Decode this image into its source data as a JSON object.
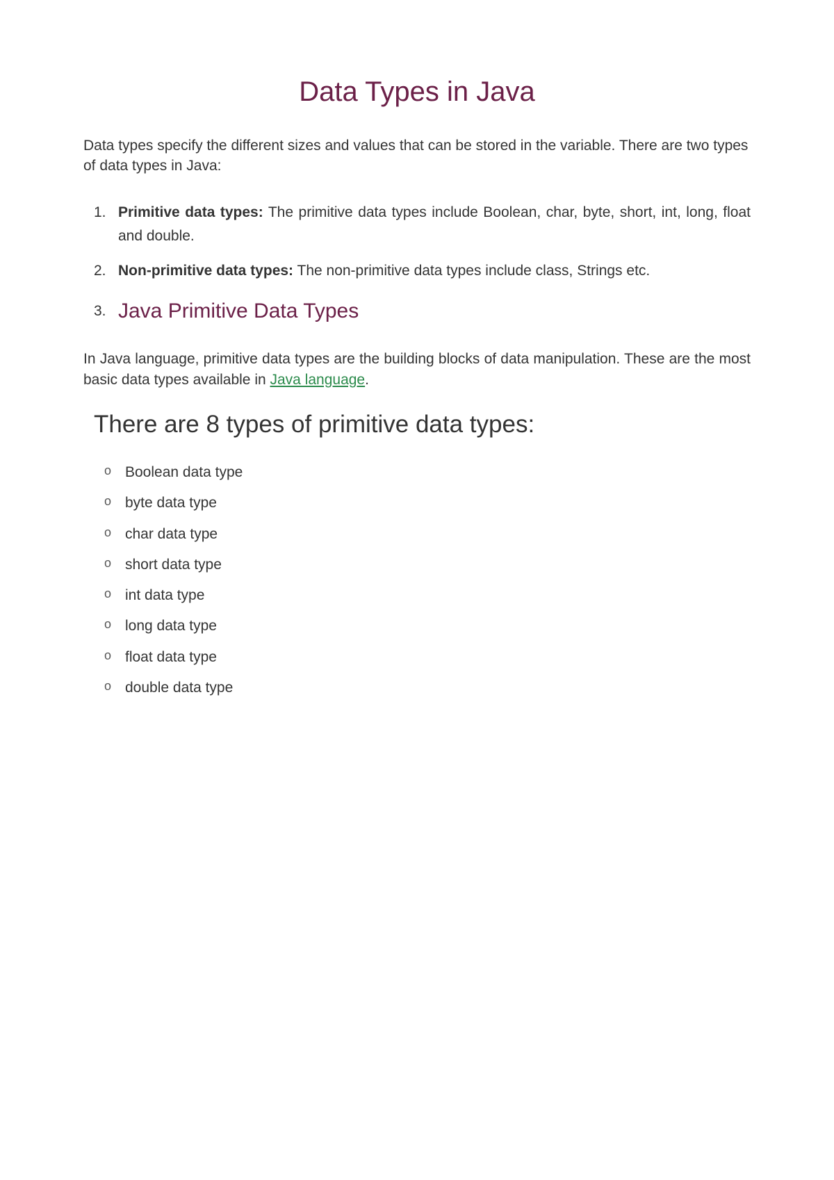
{
  "title": "Data Types in Java",
  "intro": "Data types specify the different sizes and values that can be stored in the variable. There are two types of data types in Java:",
  "list": {
    "item1": {
      "num": "1.",
      "bold": "Primitive data types:",
      "rest": " The primitive data types include Boolean, char, byte, short, int, long, float and double."
    },
    "item2": {
      "num": "2.",
      "bold": "Non-primitive data types:",
      "rest": " The non-primitive data types include class, Strings etc."
    },
    "item3": {
      "num": "3.",
      "heading": "Java Primitive Data Types"
    }
  },
  "para2": {
    "before": "In Java language, primitive data types are the building blocks of data manipulation. These are the most basic data types available in ",
    "link": "Java language",
    "after": "."
  },
  "sectionHeading": "There are 8 types of primitive data types:",
  "types": {
    "t0": "Boolean data type",
    "t1": "byte data type",
    "t2": "char data type",
    "t3": "short data type",
    "t4": "int data type",
    "t5": "long data type",
    "t6": "float data type",
    "t7": "double data type"
  }
}
